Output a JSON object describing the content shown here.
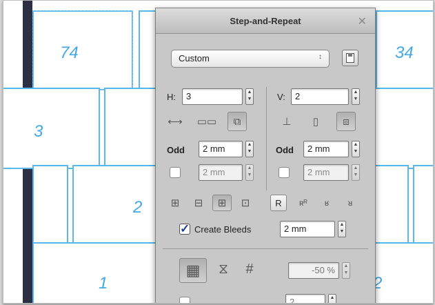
{
  "panel": {
    "title": "Step-and-Repeat",
    "close_glyph": "✕",
    "preset": {
      "value": "Custom",
      "arrow": "↕"
    },
    "h_label": "H:",
    "h_value": "3",
    "v_label": "V:",
    "v_value": "2",
    "odd_label": "Odd",
    "h_odd_value": "2 mm",
    "h_even_value": "2 mm",
    "v_odd_value": "2 mm",
    "v_even_value": "2 mm",
    "r_label": "R",
    "create_bleeds_label": "Create Bleeds",
    "create_bleeds_checked": true,
    "bleed_value": "2 mm",
    "scale_value": "-50 %",
    "bottom_value": "2"
  },
  "artboard": {
    "numbers": [
      "74",
      "34",
      "3",
      "2",
      "1",
      "2"
    ]
  },
  "colors": {
    "accent": "#43a9e4",
    "dark_bar": "#2d2f45",
    "panel_bg": "#c8c8c8"
  }
}
